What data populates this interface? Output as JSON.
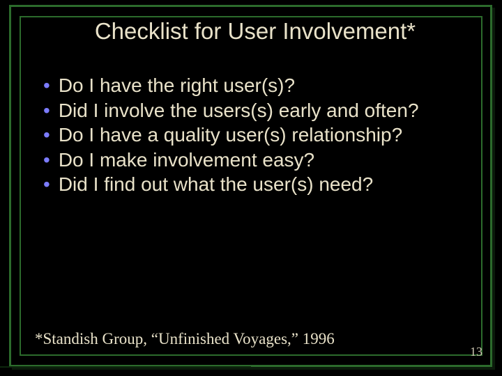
{
  "slide": {
    "title": "Checklist for User Involvement*",
    "bullets": [
      "Do I have the right user(s)?",
      "Did I involve the users(s) early and often?",
      "Do I have a quality user(s) relationship?",
      "Do I make involvement easy?",
      "Did I find out what the user(s) need?"
    ],
    "footnote": "*Standish Group, “Unfinished Voyages,” 1996",
    "page_number": "13"
  }
}
